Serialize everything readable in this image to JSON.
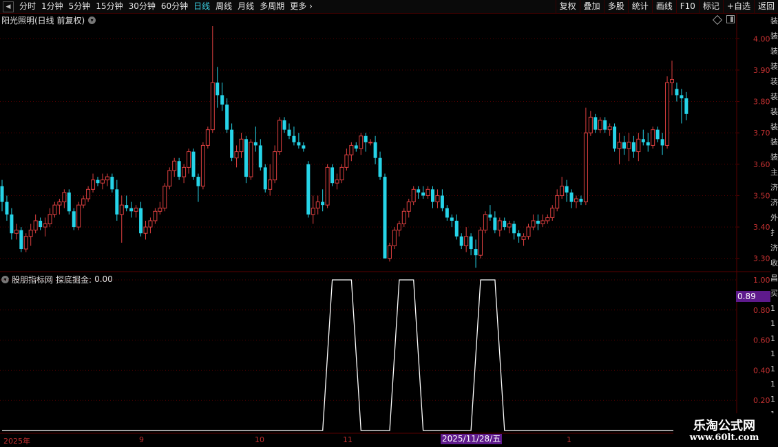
{
  "toolbar": {
    "periods": [
      "分时",
      "1分钟",
      "5分钟",
      "15分钟",
      "30分钟",
      "60分钟",
      "日线",
      "周线",
      "月线",
      "多周期",
      "更多"
    ],
    "active_period": "日线",
    "right_buttons": [
      "复权",
      "叠加",
      "多股",
      "统计",
      "画线",
      "F10",
      "标记",
      "+自选",
      "返回"
    ]
  },
  "main_chart": {
    "title": "阳光照明(日线 前复权)"
  },
  "indicator": {
    "source": "股朋指标网",
    "name": "探底掘金:",
    "value": "0.00",
    "current_badge": "0.89"
  },
  "x_axis": {
    "labels": [
      {
        "text": "2025年",
        "pos": 5
      },
      {
        "text": "9",
        "pos": 202
      },
      {
        "text": "10",
        "pos": 370
      },
      {
        "text": "11",
        "pos": 498
      },
      {
        "text": "1",
        "pos": 823
      }
    ],
    "cursor_date": "2025/11/28/五"
  },
  "right_strip_text": [
    "装",
    "装",
    "装",
    "装",
    "装",
    "装",
    "装",
    "装",
    "装",
    "装",
    "主",
    "济",
    "济",
    "外",
    "扌",
    "济",
    "收",
    "昌",
    "买",
    "1",
    "1",
    "1",
    "1",
    "1",
    "1",
    "1",
    "1"
  ],
  "watermark": {
    "line1": "乐淘公式网",
    "line2": "www.60lt.com"
  },
  "colors": {
    "up": "#e04040",
    "down": "#26d4e8",
    "grid": "#5a0000",
    "axis_text": "#c83232"
  },
  "chart_data": [
    {
      "type": "candlestick",
      "title": "阳光照明(日线 前复权)",
      "ylim": [
        3.26,
        4.04
      ],
      "y_ticks": [
        4.0,
        3.9,
        3.8,
        3.7,
        3.6,
        3.5,
        3.4,
        3.3
      ],
      "candles": [
        [
          3.53,
          3.55,
          3.45,
          3.48
        ],
        [
          3.48,
          3.5,
          3.42,
          3.44
        ],
        [
          3.44,
          3.46,
          3.36,
          3.38
        ],
        [
          3.38,
          3.41,
          3.36,
          3.39
        ],
        [
          3.39,
          3.4,
          3.32,
          3.33
        ],
        [
          3.33,
          3.38,
          3.32,
          3.37
        ],
        [
          3.37,
          3.41,
          3.34,
          3.39
        ],
        [
          3.39,
          3.44,
          3.38,
          3.42
        ],
        [
          3.42,
          3.43,
          3.39,
          3.4
        ],
        [
          3.4,
          3.43,
          3.37,
          3.41
        ],
        [
          3.41,
          3.46,
          3.4,
          3.44
        ],
        [
          3.44,
          3.48,
          3.43,
          3.47
        ],
        [
          3.47,
          3.49,
          3.44,
          3.48
        ],
        [
          3.48,
          3.52,
          3.46,
          3.51
        ],
        [
          3.51,
          3.52,
          3.44,
          3.45
        ],
        [
          3.45,
          3.46,
          3.39,
          3.4
        ],
        [
          3.4,
          3.48,
          3.39,
          3.47
        ],
        [
          3.47,
          3.5,
          3.46,
          3.49
        ],
        [
          3.49,
          3.53,
          3.48,
          3.52
        ],
        [
          3.52,
          3.57,
          3.51,
          3.55
        ],
        [
          3.55,
          3.56,
          3.53,
          3.54
        ],
        [
          3.54,
          3.57,
          3.52,
          3.55
        ],
        [
          3.55,
          3.57,
          3.53,
          3.56
        ],
        [
          3.56,
          3.57,
          3.51,
          3.52
        ],
        [
          3.52,
          3.55,
          3.42,
          3.44
        ],
        [
          3.44,
          3.5,
          3.35,
          3.47
        ],
        [
          3.47,
          3.5,
          3.45,
          3.46
        ],
        [
          3.46,
          3.48,
          3.43,
          3.45
        ],
        [
          3.45,
          3.47,
          3.43,
          3.46
        ],
        [
          3.46,
          3.48,
          3.37,
          3.38
        ],
        [
          3.38,
          3.42,
          3.36,
          3.4
        ],
        [
          3.4,
          3.43,
          3.38,
          3.42
        ],
        [
          3.42,
          3.46,
          3.41,
          3.45
        ],
        [
          3.45,
          3.48,
          3.44,
          3.46
        ],
        [
          3.46,
          3.54,
          3.45,
          3.53
        ],
        [
          3.53,
          3.59,
          3.52,
          3.58
        ],
        [
          3.58,
          3.62,
          3.56,
          3.61
        ],
        [
          3.61,
          3.62,
          3.55,
          3.56
        ],
        [
          3.56,
          3.6,
          3.54,
          3.59
        ],
        [
          3.59,
          3.65,
          3.57,
          3.64
        ],
        [
          3.64,
          3.65,
          3.55,
          3.56
        ],
        [
          3.56,
          3.57,
          3.48,
          3.53
        ],
        [
          3.53,
          3.67,
          3.52,
          3.66
        ],
        [
          3.66,
          3.72,
          3.65,
          3.71
        ],
        [
          3.71,
          4.04,
          3.7,
          3.86
        ],
        [
          3.86,
          3.91,
          3.78,
          3.82
        ],
        [
          3.82,
          3.86,
          3.77,
          3.79
        ],
        [
          3.79,
          3.81,
          3.7,
          3.71
        ],
        [
          3.71,
          3.73,
          3.61,
          3.62
        ],
        [
          3.62,
          3.66,
          3.59,
          3.64
        ],
        [
          3.64,
          3.7,
          3.62,
          3.68
        ],
        [
          3.68,
          3.69,
          3.54,
          3.56
        ],
        [
          3.56,
          3.68,
          3.55,
          3.67
        ],
        [
          3.67,
          3.72,
          3.64,
          3.66
        ],
        [
          3.66,
          3.68,
          3.58,
          3.59
        ],
        [
          3.59,
          3.6,
          3.51,
          3.52
        ],
        [
          3.52,
          3.6,
          3.5,
          3.55
        ],
        [
          3.55,
          3.66,
          3.54,
          3.64
        ],
        [
          3.64,
          3.75,
          3.63,
          3.74
        ],
        [
          3.74,
          3.75,
          3.7,
          3.71
        ],
        [
          3.71,
          3.73,
          3.68,
          3.69
        ],
        [
          3.69,
          3.72,
          3.66,
          3.67
        ],
        [
          3.67,
          3.7,
          3.65,
          3.66
        ],
        [
          3.66,
          3.67,
          3.64,
          3.65
        ],
        [
          3.6,
          3.61,
          3.43,
          3.44
        ],
        [
          3.44,
          3.5,
          3.41,
          3.46
        ],
        [
          3.46,
          3.5,
          3.44,
          3.48
        ],
        [
          3.48,
          3.52,
          3.45,
          3.47
        ],
        [
          3.47,
          3.6,
          3.46,
          3.59
        ],
        [
          3.59,
          3.6,
          3.53,
          3.54
        ],
        [
          3.54,
          3.57,
          3.52,
          3.55
        ],
        [
          3.55,
          3.6,
          3.54,
          3.59
        ],
        [
          3.59,
          3.65,
          3.58,
          3.63
        ],
        [
          3.63,
          3.67,
          3.61,
          3.66
        ],
        [
          3.66,
          3.67,
          3.64,
          3.65
        ],
        [
          3.65,
          3.7,
          3.63,
          3.69
        ],
        [
          3.69,
          3.7,
          3.64,
          3.67
        ],
        [
          3.67,
          3.68,
          3.66,
          3.67
        ],
        [
          3.67,
          3.69,
          3.6,
          3.62
        ],
        [
          3.62,
          3.64,
          3.55,
          3.56
        ],
        [
          3.56,
          3.57,
          3.3,
          3.3
        ],
        [
          3.3,
          3.35,
          3.29,
          3.34
        ],
        [
          3.34,
          3.4,
          3.33,
          3.39
        ],
        [
          3.39,
          3.42,
          3.37,
          3.41
        ],
        [
          3.41,
          3.46,
          3.4,
          3.45
        ],
        [
          3.45,
          3.49,
          3.43,
          3.48
        ],
        [
          3.48,
          3.53,
          3.47,
          3.52
        ],
        [
          3.52,
          3.53,
          3.49,
          3.51
        ],
        [
          3.51,
          3.53,
          3.49,
          3.5
        ],
        [
          3.5,
          3.53,
          3.49,
          3.52
        ],
        [
          3.52,
          3.53,
          3.46,
          3.48
        ],
        [
          3.48,
          3.52,
          3.46,
          3.5
        ],
        [
          3.5,
          3.52,
          3.45,
          3.46
        ],
        [
          3.46,
          3.47,
          3.42,
          3.43
        ],
        [
          3.43,
          3.44,
          3.4,
          3.42
        ],
        [
          3.42,
          3.44,
          3.36,
          3.37
        ],
        [
          3.37,
          3.38,
          3.33,
          3.34
        ],
        [
          3.34,
          3.4,
          3.32,
          3.37
        ],
        [
          3.37,
          3.38,
          3.31,
          3.33
        ],
        [
          3.33,
          3.36,
          3.27,
          3.31
        ],
        [
          3.31,
          3.4,
          3.3,
          3.39
        ],
        [
          3.39,
          3.45,
          3.38,
          3.44
        ],
        [
          3.44,
          3.47,
          3.42,
          3.43
        ],
        [
          3.43,
          3.45,
          3.38,
          3.39
        ],
        [
          3.39,
          3.43,
          3.37,
          3.42
        ],
        [
          3.42,
          3.43,
          3.39,
          3.4
        ],
        [
          3.4,
          3.42,
          3.38,
          3.41
        ],
        [
          3.41,
          3.42,
          3.36,
          3.38
        ],
        [
          3.38,
          3.39,
          3.35,
          3.37
        ],
        [
          3.36,
          3.38,
          3.34,
          3.37
        ],
        [
          3.37,
          3.41,
          3.36,
          3.4
        ],
        [
          3.4,
          3.44,
          3.39,
          3.42
        ],
        [
          3.42,
          3.44,
          3.39,
          3.41
        ],
        [
          3.41,
          3.44,
          3.4,
          3.42
        ],
        [
          3.42,
          3.44,
          3.41,
          3.43
        ],
        [
          3.43,
          3.47,
          3.42,
          3.46
        ],
        [
          3.46,
          3.52,
          3.45,
          3.5
        ],
        [
          3.5,
          3.56,
          3.49,
          3.53
        ],
        [
          3.53,
          3.55,
          3.48,
          3.51
        ],
        [
          3.51,
          3.52,
          3.46,
          3.48
        ],
        [
          3.48,
          3.5,
          3.46,
          3.49
        ],
        [
          3.49,
          3.5,
          3.47,
          3.48
        ],
        [
          3.48,
          3.78,
          3.47,
          3.7
        ],
        [
          3.7,
          3.77,
          3.69,
          3.75
        ],
        [
          3.75,
          3.76,
          3.7,
          3.71
        ],
        [
          3.71,
          3.75,
          3.7,
          3.74
        ],
        [
          3.74,
          3.75,
          3.7,
          3.71
        ],
        [
          3.71,
          3.73,
          3.69,
          3.72
        ],
        [
          3.72,
          3.73,
          3.64,
          3.65
        ],
        [
          3.65,
          3.7,
          3.6,
          3.67
        ],
        [
          3.67,
          3.69,
          3.63,
          3.65
        ],
        [
          3.65,
          3.7,
          3.61,
          3.67
        ],
        [
          3.67,
          3.69,
          3.62,
          3.64
        ],
        [
          3.64,
          3.7,
          3.61,
          3.68
        ],
        [
          3.68,
          3.71,
          3.66,
          3.67
        ],
        [
          3.67,
          3.7,
          3.64,
          3.66
        ],
        [
          3.66,
          3.72,
          3.65,
          3.71
        ],
        [
          3.71,
          3.72,
          3.67,
          3.68
        ],
        [
          3.68,
          3.7,
          3.63,
          3.66
        ],
        [
          3.66,
          3.88,
          3.65,
          3.86
        ],
        [
          3.86,
          3.93,
          3.82,
          3.87
        ],
        [
          3.84,
          3.86,
          3.8,
          3.82
        ],
        [
          3.82,
          3.84,
          3.73,
          3.81
        ],
        [
          3.81,
          3.83,
          3.74,
          3.76
        ]
      ]
    },
    {
      "type": "line",
      "title": "探底掘金",
      "ylim": [
        0.0,
        1.05
      ],
      "y_ticks": [
        1.0,
        0.8,
        0.6,
        0.4,
        0.2
      ],
      "series": [
        {
          "values_by_segment": [
            {
              "from": 0,
              "to": 67,
              "value": 0
            },
            {
              "from": 69,
              "to": 73,
              "value": 1
            },
            {
              "from": 75,
              "to": 81,
              "value": 0
            },
            {
              "from": 83,
              "to": 86,
              "value": 1
            },
            {
              "from": 88,
              "to": 98,
              "value": 0
            },
            {
              "from": 100,
              "to": 103,
              "value": 1
            },
            {
              "from": 105,
              "to": 148,
              "value": 0
            }
          ]
        }
      ]
    }
  ]
}
